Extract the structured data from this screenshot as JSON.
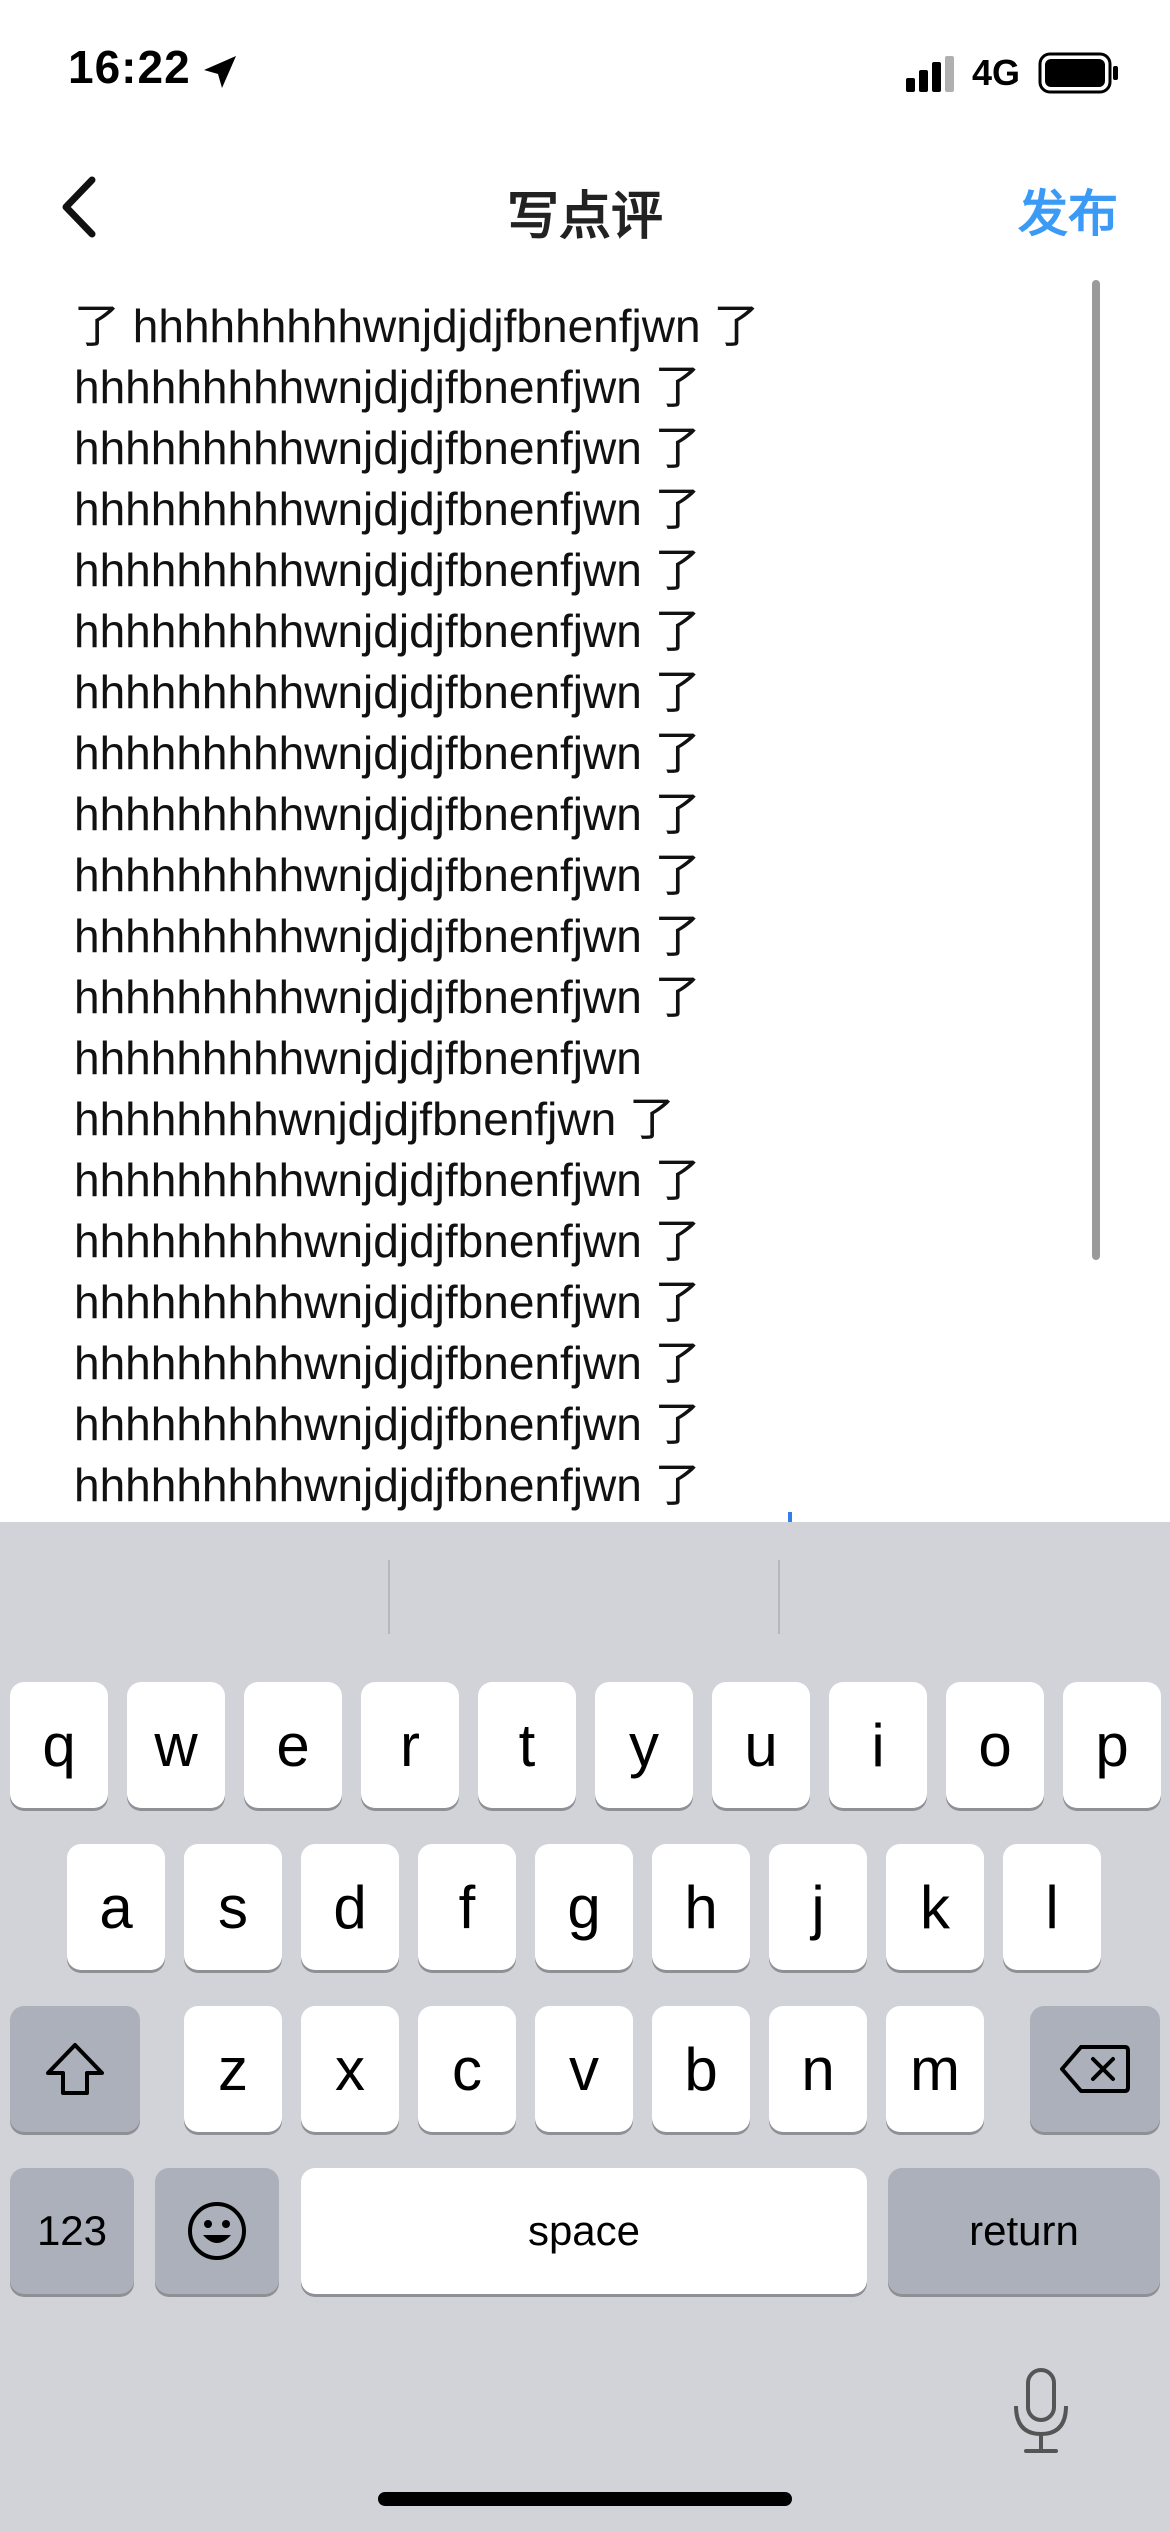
{
  "status_bar": {
    "time": "16:22",
    "network": "4G"
  },
  "nav": {
    "title": "写点评",
    "publish_label": "发布"
  },
  "editor": {
    "lines": [
      "了 hhhhhhhhhwnjdjdjfbnenfjwn 了",
      "hhhhhhhhhwnjdjdjfbnenfjwn 了",
      "hhhhhhhhhwnjdjdjfbnenfjwn 了",
      "hhhhhhhhhwnjdjdjfbnenfjwn 了",
      "hhhhhhhhhwnjdjdjfbnenfjwn 了",
      "hhhhhhhhhwnjdjdjfbnenfjwn 了",
      "hhhhhhhhhwnjdjdjfbnenfjwn 了",
      "hhhhhhhhhwnjdjdjfbnenfjwn 了",
      "hhhhhhhhhwnjdjdjfbnenfjwn 了",
      "hhhhhhhhhwnjdjdjfbnenfjwn 了",
      "hhhhhhhhhwnjdjdjfbnenfjwn 了",
      "hhhhhhhhhwnjdjdjfbnenfjwn 了",
      "hhhhhhhhhwnjdjdjfbnenfjwn",
      "hhhhhhhhwnjdjdjfbnenfjwn 了",
      "hhhhhhhhhwnjdjdjfbnenfjwn 了",
      "hhhhhhhhhwnjdjdjfbnenfjwn 了",
      "hhhhhhhhhwnjdjdjfbnenfjwn 了",
      "hhhhhhhhhwnjdjdjfbnenfjwn 了",
      "hhhhhhhhhwnjdjdjfbnenfjwn 了",
      "hhhhhhhhhwnjdjdjfbnenfjwn 了"
    ]
  },
  "keyboard": {
    "row1": [
      "q",
      "w",
      "e",
      "r",
      "t",
      "y",
      "u",
      "i",
      "o",
      "p"
    ],
    "row2": [
      "a",
      "s",
      "d",
      "f",
      "g",
      "h",
      "j",
      "k",
      "l"
    ],
    "row3": [
      "z",
      "x",
      "c",
      "v",
      "b",
      "n",
      "m"
    ],
    "numbers_label": "123",
    "space_label": "space",
    "return_label": "return"
  },
  "colors": {
    "accent": "#3b9af5",
    "keyboard_bg": "#d1d3d9",
    "key_dark": "#abb0ba"
  }
}
